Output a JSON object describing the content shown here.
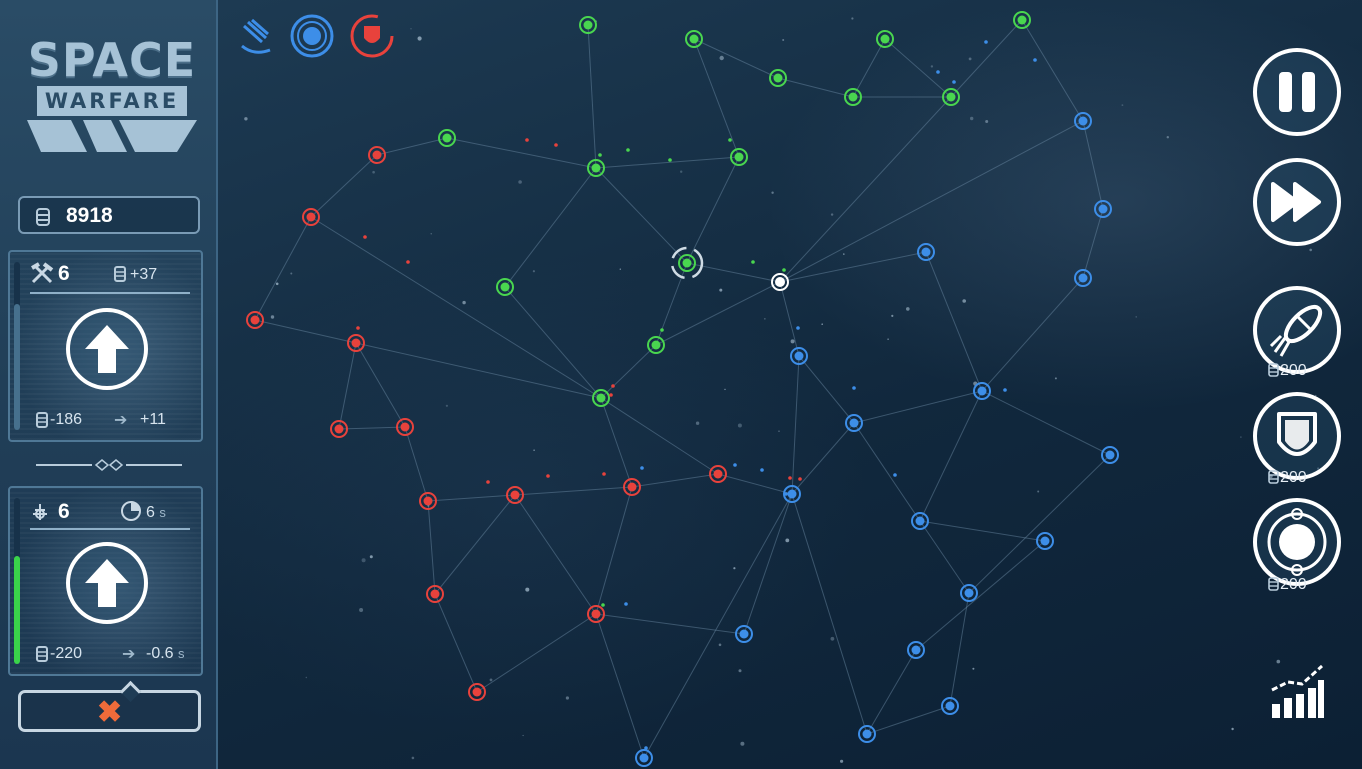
{
  "sidebar": {
    "logo": {
      "line1": "SPACE",
      "line2": "WARFARE"
    },
    "coins": "8918",
    "production_panel": {
      "level": "6",
      "income": "+37",
      "cost": "-186",
      "bonus": "+11",
      "fill_fraction": 0.75
    },
    "spawn_panel": {
      "level": "6",
      "interval": "6",
      "interval_unit": "s",
      "cost": "-220",
      "bonus": "-0.6",
      "bonus_unit": "s",
      "fill_fraction": 0.65
    },
    "cancel_icon": "close-icon"
  },
  "top_icons": [
    "fleet-icon",
    "planet-target-icon",
    "shield-icon"
  ],
  "right_controls": {
    "pause": "pause-icon",
    "fast_forward": "fast-forward-icon",
    "abilities": [
      {
        "name": "rocket-ability",
        "cost": "200"
      },
      {
        "name": "shield-ability",
        "cost": "200"
      },
      {
        "name": "planet-ability",
        "cost": "200"
      }
    ],
    "stats": "stats-chart-icon"
  },
  "colors": {
    "green": "#49d64f",
    "red": "#e8423c",
    "blue": "#3d8ee8",
    "neutral": "#ffffff",
    "fill_bar": "#3ad44a",
    "fill_bar_dim": "#46708d"
  }
}
